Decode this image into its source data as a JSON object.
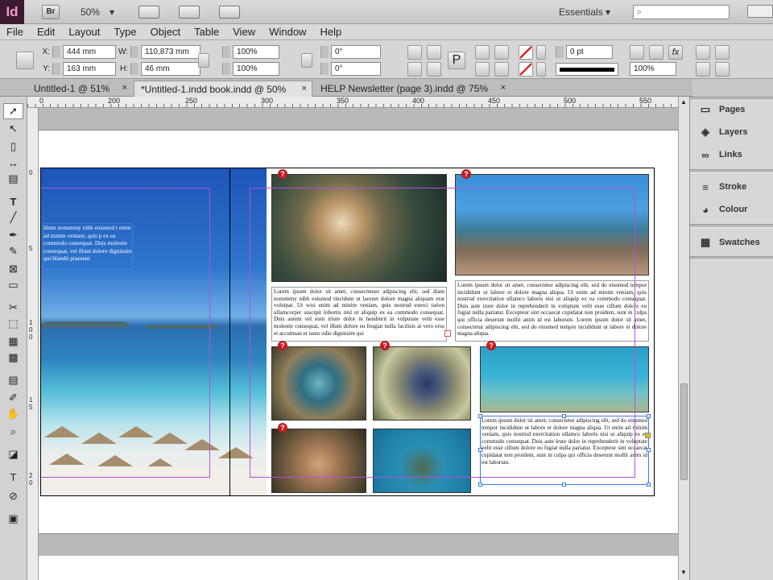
{
  "app": {
    "logo": "Id",
    "bridge": "Br",
    "zoom": "50%",
    "workspace": "Essentials"
  },
  "menu": [
    "File",
    "Edit",
    "Layout",
    "Type",
    "Object",
    "Table",
    "View",
    "Window",
    "Help"
  ],
  "control": {
    "x_label": "X:",
    "x_value": "444 mm",
    "y_label": "Y:",
    "y_value": "163 mm",
    "w_label": "W:",
    "w_value": "110,873 mm",
    "h_label": "H:",
    "h_value": "46 mm",
    "scale_x": "100%",
    "scale_y": "100%",
    "rotate": "0°",
    "shear": "0°",
    "stroke_weight": "0 pt",
    "opacity": "100%"
  },
  "tabs": [
    {
      "label": "Untitled-1 @ 51%"
    },
    {
      "label": "*Untitled-1.indd book.indd @ 50%"
    },
    {
      "label": "HELP Newsletter (page 3).indd @ 75%"
    }
  ],
  "ruler_h": [
    "0",
    "200",
    "250",
    "300",
    "350",
    "400",
    "450",
    "500",
    "550"
  ],
  "ruler_v": [
    "0",
    "5",
    "1 0 0",
    "1 5",
    "2 0"
  ],
  "panels": {
    "pages": "Pages",
    "layers": "Layers",
    "links": "Links",
    "stroke": "Stroke",
    "colour": "Colour",
    "swatches": "Swatches"
  },
  "document": {
    "beach_text": "illum nonummy nibh euismod t enim ad minim veniam, quis p ex ea commodo consequat. Duis molestie consequat, vel illum dolore dignissim qui blandit praesent",
    "text1": "Lorem ipsum dolor sit amet, consectetuer adipiscing elit, sed diam nonummy nibh euismod tincidunt ut laoreet dolore magna aliquam erat volutpat. Ut wisi enim ad minim veniam, quis nostrud exerci tation ullamcorper suscipit lobortis nisl ut aliquip ex ea commodo consequat. Duis autem vel eum iriure dolor in hendrerit in vulputate velit esse molestie consequat, vel illum dolore eu feugiat nulla facilisis at vero eros et accumsan et iusto odio dignissim qui",
    "text2": "Lorem ipsum dolor sit amet, consectetur adipiscing elit, sed do eiusmod tempor incididunt ut labore et dolore magna aliqua. Ut enim ad minim veniam, quis nostrud exercitation ullamco laboris nisi ut aliquip ex ea commodo consequat. Duis aute irure dolor in reprehenderit in voluptate velit esse cillum dolore eu fugiat nulla pariatur. Excepteur sint occaecat cupidatat non proident, sunt in culpa qui officia deserunt mollit anim id est laborum. Lorem ipsum dolor sit amet, consectetur adipiscing elit, sed do eiusmod tempor incididunt ut labore et dolore magna aliqua.",
    "text3": "Lorem ipsum dolor sit amet, consectetur adipiscing elit, sed do eiusmod tempor incididunt ut labore et dolore magna aliqua. Ut enim ad minim veniam, quis nostrud exercitation ullamco laboris nisi ut aliquip ex ea commodo consequat. Duis aute irure dolor in reprehenderit in voluptate velit esse cillum dolore eu fugiat nulla pariatur. Excepteur sint occaecat cupidatat non proident, sunt in culpa qui officia deserunt mollit anim id est laborum.",
    "missing_link_mark": "?"
  },
  "colors": {
    "accent": "#3a7be0",
    "margin_guide": "#b44fe0",
    "missing_link": "#c21b22",
    "app_logo_bg": "#3b1b2f"
  }
}
